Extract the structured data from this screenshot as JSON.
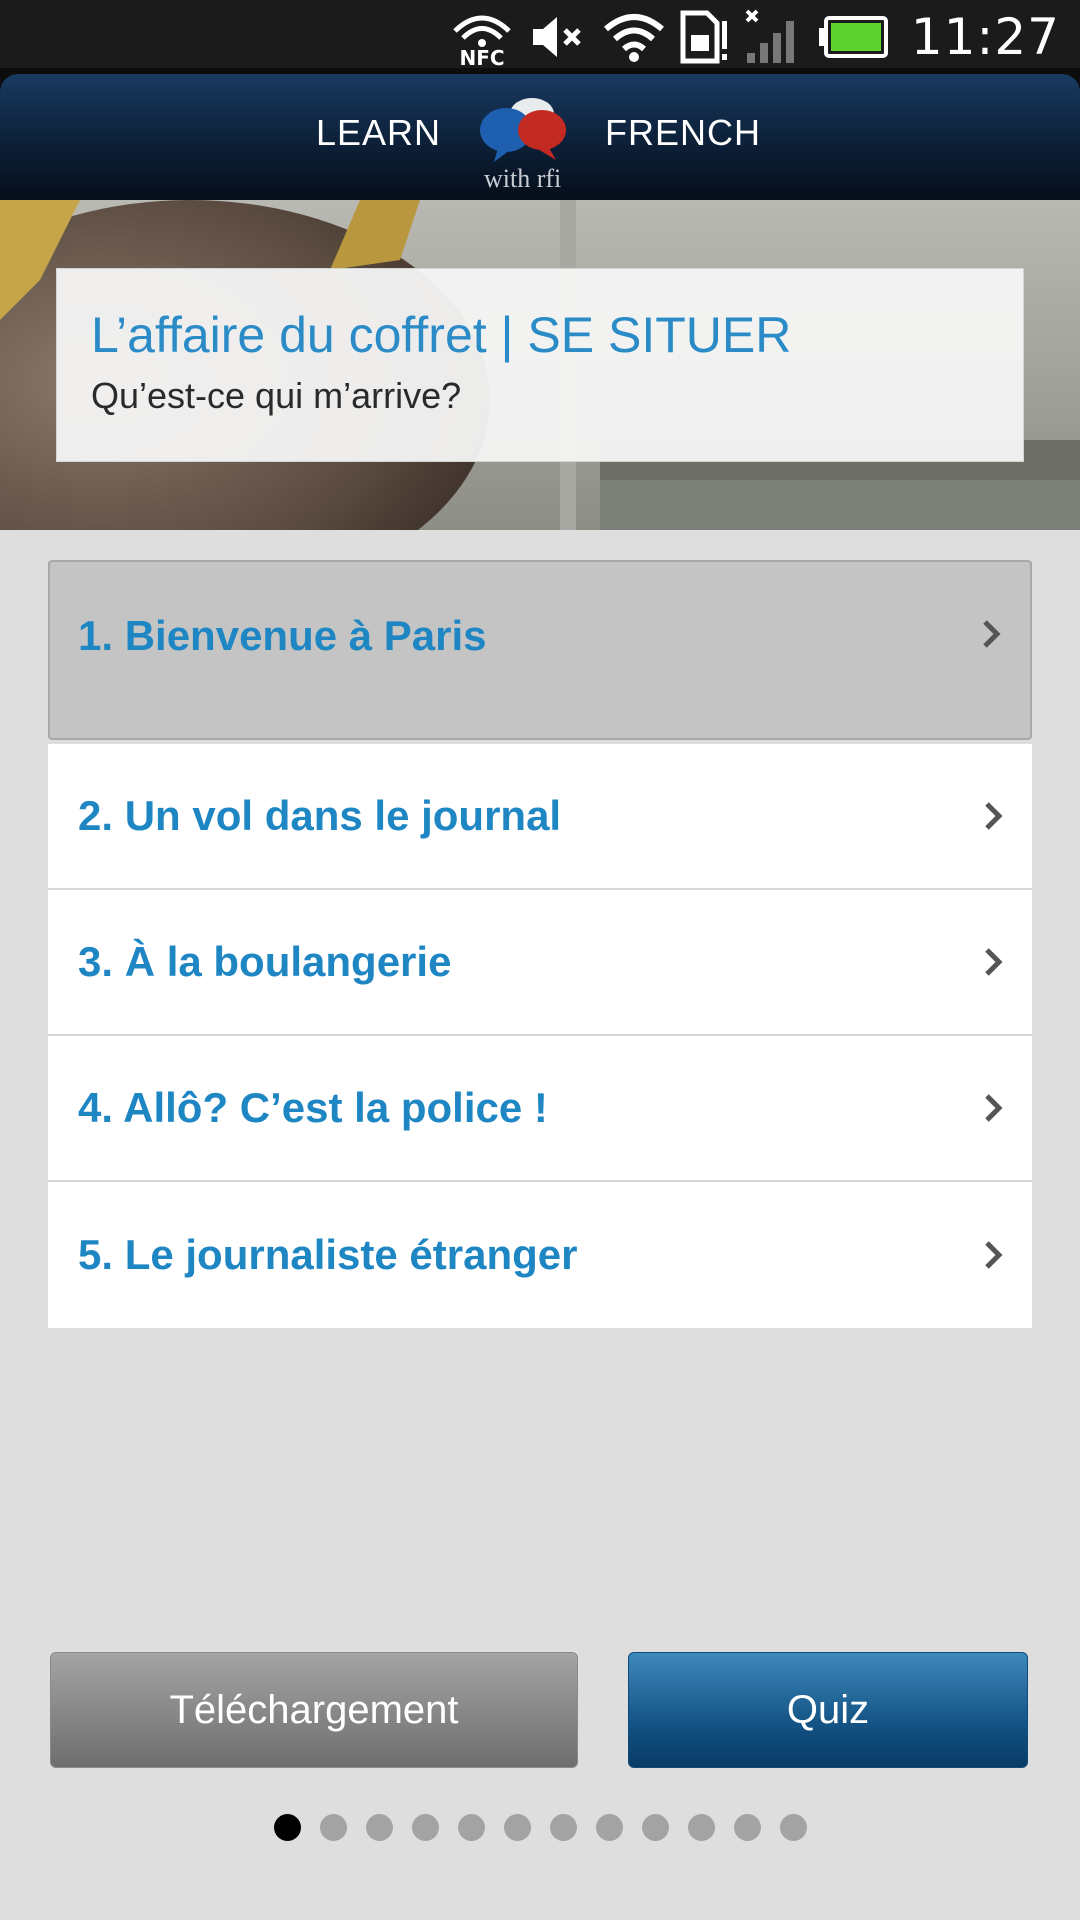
{
  "status_bar": {
    "nfc_label": "NFC",
    "time": "11:27",
    "icons": [
      "nfc-icon",
      "mute-icon",
      "wifi-icon",
      "sim-warning-icon",
      "signal-icon",
      "battery-icon"
    ],
    "battery_color": "#5ed330"
  },
  "header": {
    "logo_left": "LEARN",
    "logo_right": "FRENCH",
    "logo_sub": "with rfi",
    "colors": {
      "bubble_blue": "#1e5fb0",
      "bubble_red": "#c32a22"
    }
  },
  "banner": {
    "title": "L’affaire du coffret | SE SITUER",
    "subtitle": "Qu’est-ce qui m’arrive?"
  },
  "chapters": [
    {
      "label": "1. Bienvenue à Paris",
      "selected": true
    },
    {
      "label": "2. Un vol dans le journal"
    },
    {
      "label": "3. À la boulangerie"
    },
    {
      "label": "4. Allô? C’est la police !"
    },
    {
      "label": "5. Le journaliste étranger"
    }
  ],
  "buttons": {
    "download_label": "Téléchargement",
    "quiz_label": "Quiz"
  },
  "pager": {
    "total_pages": 12,
    "current_page": 1
  },
  "colors": {
    "accent": "#1f86c4",
    "quiz_button": "#0f4d7e",
    "background": "#dedede"
  }
}
